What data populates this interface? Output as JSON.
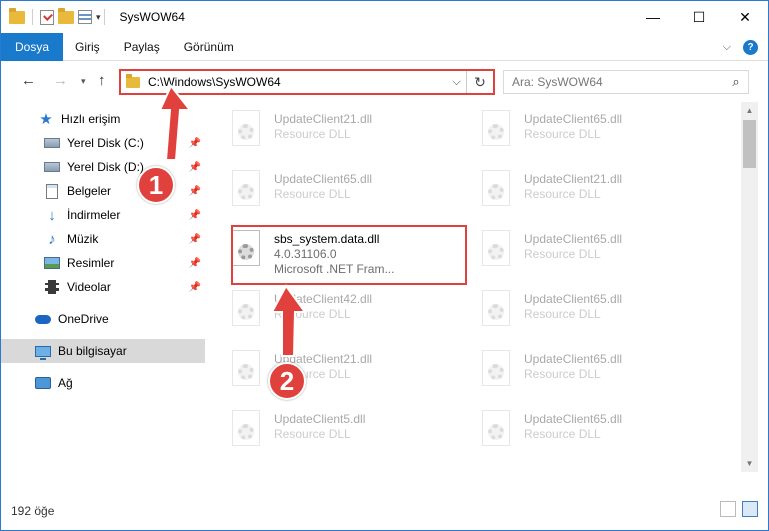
{
  "window": {
    "title": "SysWOW64",
    "controls": {
      "minimize": "—",
      "maximize": "☐",
      "close": "✕"
    }
  },
  "ribbon": {
    "tabs": [
      {
        "label": "Dosya",
        "active": true
      },
      {
        "label": "Giriş"
      },
      {
        "label": "Paylaş"
      },
      {
        "label": "Görünüm"
      }
    ],
    "help": "?"
  },
  "address": {
    "path": "C:\\Windows\\SysWOW64",
    "search_placeholder": "Ara: SysWOW64"
  },
  "sidebar": {
    "items": [
      {
        "label": "Hızlı erişim",
        "icon": "star-icon"
      },
      {
        "label": "Yerel Disk (C:)",
        "icon": "drive-icon",
        "pinned": true
      },
      {
        "label": "Yerel Disk (D:)",
        "icon": "drive-icon",
        "pinned": true
      },
      {
        "label": "Belgeler",
        "icon": "documents-icon",
        "pinned": true
      },
      {
        "label": "İndirmeler",
        "icon": "downloads-icon",
        "pinned": true
      },
      {
        "label": "Müzik",
        "icon": "music-icon",
        "pinned": true
      },
      {
        "label": "Resimler",
        "icon": "pictures-icon",
        "pinned": true
      },
      {
        "label": "Videolar",
        "icon": "videos-icon",
        "pinned": true
      },
      {
        "label": "OneDrive",
        "icon": "onedrive-icon"
      },
      {
        "label": "Bu bilgisayar",
        "icon": "computer-icon",
        "selected": true
      },
      {
        "label": "Ağ",
        "icon": "network-icon"
      }
    ]
  },
  "files": [
    {
      "name": "UpdateClient21.dll",
      "type": "Resource DLL"
    },
    {
      "name": "UpdateClient65.dll",
      "type": "Resource DLL"
    },
    {
      "name": "UpdateClient65.dll",
      "type": "Resource DLL"
    },
    {
      "name": "UpdateClient21.dll",
      "type": "Resource DLL"
    },
    {
      "name": "sbs_system.data.dll",
      "version": "4.0.31106.0",
      "company": "Microsoft .NET Fram...",
      "highlighted": true
    },
    {
      "name": "UpdateClient65.dll",
      "type": "Resource DLL"
    },
    {
      "name": "UpdateClient42.dll",
      "type": "Resource DLL"
    },
    {
      "name": "UpdateClient65.dll",
      "type": "Resource DLL"
    },
    {
      "name": "UpdateClient21.dll",
      "type": "Resource DLL"
    },
    {
      "name": "UpdateClient65.dll",
      "type": "Resource DLL"
    },
    {
      "name": "UpdateClient5.dll",
      "type": "Resource DLL"
    },
    {
      "name": "UpdateClient65.dll",
      "type": "Resource DLL"
    }
  ],
  "status": {
    "count": "192 öğe"
  },
  "annotations": {
    "step1": "1",
    "step2": "2"
  },
  "colors": {
    "accent": "#1979ca",
    "annotation": "#e0413c"
  }
}
